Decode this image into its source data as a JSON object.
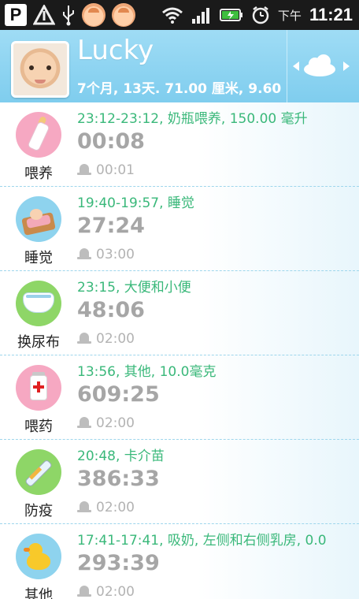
{
  "status_bar": {
    "app_indicator": "P",
    "ampm": "下午",
    "time": "11:21",
    "icons": [
      "parking-icon",
      "usb-debug-icon",
      "usb-icon",
      "baby-face-icon",
      "baby-face-icon",
      "wifi-icon",
      "signal-icon",
      "battery-charging-icon",
      "alarm-icon"
    ]
  },
  "header": {
    "name": "Lucky",
    "stats": "7个月, 13天. 71.00 厘米, 9.60",
    "weather_icon": "cloud-icon"
  },
  "records": [
    {
      "icon": "bottle-icon",
      "category": "喂养",
      "detail": "23:12-23:12, 奶瓶喂养, 150.00 毫升",
      "elapsed": "00:08",
      "alarm": "00:01"
    },
    {
      "icon": "sleeping-baby-icon",
      "category": "睡觉",
      "detail": "19:40-19:57, 睡觉",
      "elapsed": "27:24",
      "alarm": "03:00"
    },
    {
      "icon": "diaper-icon",
      "category": "换尿布",
      "detail": "23:15, 大便和小便",
      "elapsed": "48:06",
      "alarm": "02:00"
    },
    {
      "icon": "medicine-icon",
      "category": "喂药",
      "detail": "13:56, 其他, 10.0毫克",
      "elapsed": "609:25",
      "alarm": "02:00"
    },
    {
      "icon": "syringe-icon",
      "category": "防疫",
      "detail": "20:48, 卡介苗",
      "elapsed": "386:33",
      "alarm": "02:00"
    },
    {
      "icon": "duck-icon",
      "category": "其他",
      "detail": "17:41-17:41, 吸奶, 左侧和右侧乳房, 0.0",
      "elapsed": "293:39",
      "alarm": "02:00"
    }
  ],
  "colors": {
    "header_bg": "#8fd4f1",
    "detail_text": "#3ab87a",
    "elapsed_text": "#a6a6a6",
    "divider": "#9ed6ec"
  }
}
